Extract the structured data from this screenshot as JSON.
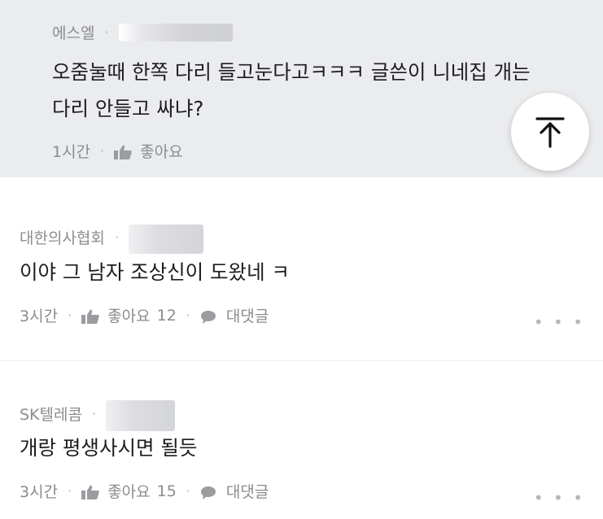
{
  "reply": {
    "author": "에스엘",
    "text": "오줌눌때 한쪽 다리 들고눈다고ㅋㅋㅋ 글쓴이 니네집 개는 다리 안들고 싸냐?",
    "time": "1시간",
    "like_label": "좋아요"
  },
  "comments": [
    {
      "author": "대한의사협회",
      "text": "이야 그 남자 조상신이 도왔네 ㅋ",
      "time": "3시간",
      "like_label": "좋아요",
      "like_count": "12",
      "reply_label": "대댓글",
      "more": "• • •"
    },
    {
      "author": "SK텔레콤",
      "text": "개랑 평생사시면 될듯",
      "time": "3시간",
      "like_label": "좋아요",
      "like_count": "15",
      "reply_label": "대댓글",
      "more": "• • •"
    }
  ],
  "separator": "·",
  "icons": {
    "like": "thumbs-up-icon",
    "reply": "comment-bubble-icon",
    "top": "arrow-up-icon"
  },
  "colors": {
    "reply_bg": "#ebecee",
    "meta_text": "#8a8c90",
    "body_text": "#1d1d1f"
  }
}
